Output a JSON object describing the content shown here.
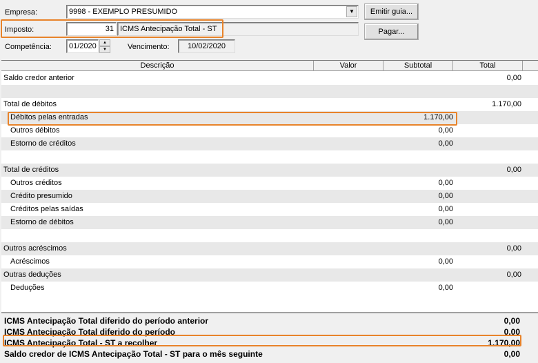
{
  "form": {
    "empresa_label": "Empresa:",
    "empresa_value": "9998 - EXEMPLO PRESUMIDO",
    "imposto_label": "Imposto:",
    "imposto_code": "31",
    "imposto_desc": "ICMS Antecipação Total - ST",
    "competencia_label": "Competência:",
    "competencia_value": "01/2020",
    "vencimento_label": "Vencimento:",
    "vencimento_value": "10/02/2020",
    "emitir_guia_label": "Emitir guia...",
    "pagar_label": "Pagar..."
  },
  "grid": {
    "columns": [
      "Descrição",
      "Valor",
      "Subtotal",
      "Total"
    ],
    "rows": [
      {
        "desc": "Saldo credor anterior",
        "indent": false,
        "subtotal": "",
        "total": "0,00"
      },
      {
        "desc": "",
        "indent": false,
        "subtotal": "",
        "total": ""
      },
      {
        "desc": "Total de débitos",
        "indent": false,
        "subtotal": "",
        "total": "1.170,00"
      },
      {
        "desc": "Débitos pelas entradas",
        "indent": true,
        "subtotal": "1.170,00",
        "total": ""
      },
      {
        "desc": "Outros débitos",
        "indent": true,
        "subtotal": "0,00",
        "total": ""
      },
      {
        "desc": "Estorno de créditos",
        "indent": true,
        "subtotal": "0,00",
        "total": ""
      },
      {
        "desc": "",
        "indent": false,
        "subtotal": "",
        "total": ""
      },
      {
        "desc": "Total de créditos",
        "indent": false,
        "subtotal": "",
        "total": "0,00"
      },
      {
        "desc": "Outros créditos",
        "indent": true,
        "subtotal": "0,00",
        "total": ""
      },
      {
        "desc": "Crédito presumido",
        "indent": true,
        "subtotal": "0,00",
        "total": ""
      },
      {
        "desc": "Créditos pelas saídas",
        "indent": true,
        "subtotal": "0,00",
        "total": ""
      },
      {
        "desc": "Estorno de débitos",
        "indent": true,
        "subtotal": "0,00",
        "total": ""
      },
      {
        "desc": "",
        "indent": false,
        "subtotal": "",
        "total": ""
      },
      {
        "desc": "Outros acréscimos",
        "indent": false,
        "subtotal": "",
        "total": "0,00"
      },
      {
        "desc": "Acréscimos",
        "indent": true,
        "subtotal": "0,00",
        "total": ""
      },
      {
        "desc": "Outras deduções",
        "indent": false,
        "subtotal": "",
        "total": "0,00"
      },
      {
        "desc": "Deduções",
        "indent": true,
        "subtotal": "0,00",
        "total": ""
      }
    ],
    "summary": [
      {
        "desc": "ICMS Antecipação Total diferido do período anterior",
        "value": "0,00"
      },
      {
        "desc": "ICMS Antecipação Total diferido do período",
        "value": "0,00"
      },
      {
        "desc": "ICMS Antecipação Total - ST a recolher",
        "value": "1.170,00"
      },
      {
        "desc": "Saldo credor de ICMS Antecipação Total - ST para o mês seguinte",
        "value": "0,00"
      }
    ]
  },
  "colors": {
    "highlight": "#e8832a",
    "row_alt": "#e8e8e8"
  }
}
